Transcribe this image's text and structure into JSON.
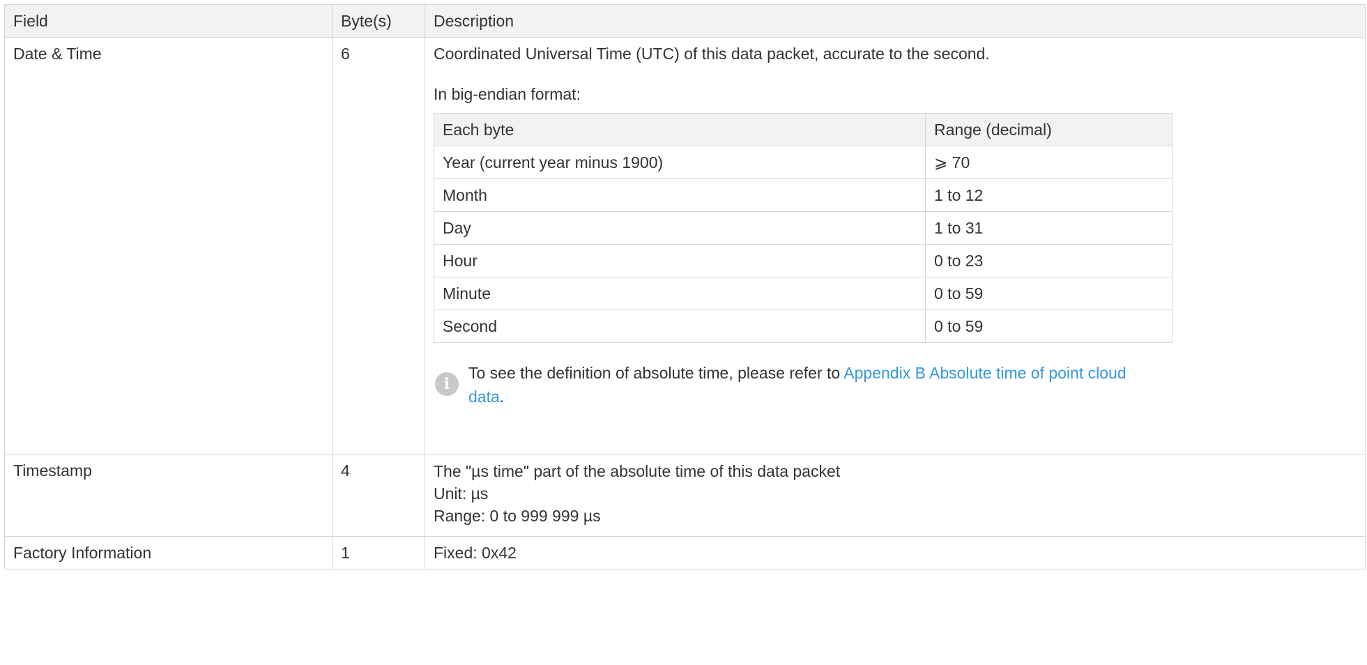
{
  "headers": {
    "field": "Field",
    "bytes": "Byte(s)",
    "description": "Description"
  },
  "rows": {
    "date_time": {
      "field": "Date & Time",
      "bytes": "6",
      "desc_line1": "Coordinated Universal Time (UTC) of this data packet, accurate to the second.",
      "desc_line2": "In big-endian format:",
      "inner_headers": {
        "each_byte": "Each byte",
        "range": "Range (decimal)"
      },
      "inner_rows": [
        {
          "each_byte": "Year (current year minus 1900)",
          "range": "⩾ 70"
        },
        {
          "each_byte": "Month",
          "range": "1 to 12"
        },
        {
          "each_byte": "Day",
          "range": "1 to 31"
        },
        {
          "each_byte": "Hour",
          "range": "0 to 23"
        },
        {
          "each_byte": "Minute",
          "range": "0 to 59"
        },
        {
          "each_byte": "Second",
          "range": "0 to 59"
        }
      ],
      "note_prefix": "To see the definition of absolute time, please refer to ",
      "note_link": "Appendix B Absolute time of point cloud data",
      "note_suffix": ".",
      "note_icon": "info-icon"
    },
    "timestamp": {
      "field": "Timestamp",
      "bytes": "4",
      "line1": "The \"µs time\" part of the absolute time of this data packet",
      "line2": "Unit: µs",
      "line3": "Range: 0 to 999 999 µs"
    },
    "factory": {
      "field": "Factory Information",
      "bytes": "1",
      "description": "Fixed: 0x42"
    }
  },
  "colors": {
    "link": "#3498db",
    "header_bg": "#f2f2f2",
    "border": "#d6d6d6",
    "icon_bg": "#c8c8c8"
  }
}
